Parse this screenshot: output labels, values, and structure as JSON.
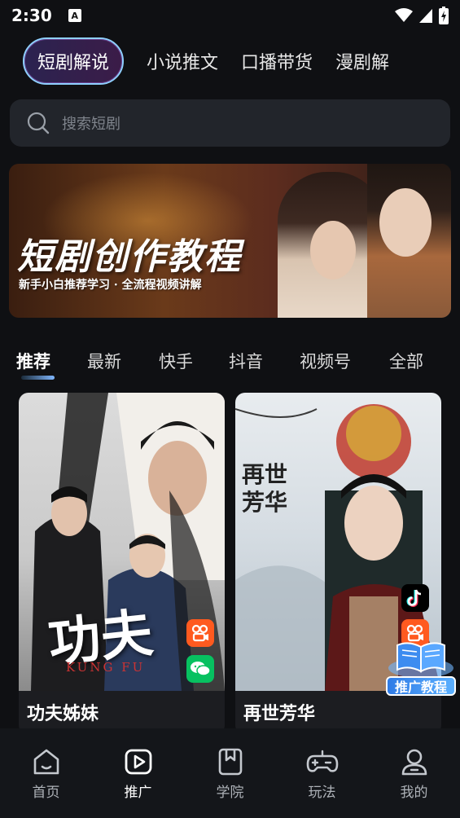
{
  "status": {
    "time": "2:30",
    "app_letter": "A"
  },
  "top_tabs": [
    {
      "label": "短剧解说",
      "active": true
    },
    {
      "label": "小说推文",
      "active": false
    },
    {
      "label": "口播带货",
      "active": false
    },
    {
      "label": "漫剧解",
      "active": false
    }
  ],
  "search": {
    "placeholder": "搜索短剧"
  },
  "banner": {
    "title": "短剧创作教程",
    "subtitle": "新手小白推荐学习 · 全流程视频讲解"
  },
  "category_tabs": [
    {
      "label": "推荐",
      "active": true
    },
    {
      "label": "最新",
      "active": false
    },
    {
      "label": "快手",
      "active": false
    },
    {
      "label": "抖音",
      "active": false
    },
    {
      "label": "视频号",
      "active": false
    },
    {
      "label": "全部",
      "active": false
    }
  ],
  "cards": [
    {
      "title": "功夫姊妹",
      "poster_text_cn": "功夫",
      "poster_text_en": "KUNG FU",
      "platform_icons": [
        "kuaishou-icon",
        "wechat-channels-icon"
      ]
    },
    {
      "title": "再世芳华",
      "poster_text_cn": "再世芳华",
      "platform_icons": [
        "douyin-icon",
        "kuaishou-icon"
      ]
    }
  ],
  "float_button": {
    "label": "推广教程"
  },
  "bottom_nav": [
    {
      "label": "首页",
      "icon": "home-icon",
      "active": false
    },
    {
      "label": "推广",
      "icon": "play-square-icon",
      "active": true
    },
    {
      "label": "学院",
      "icon": "bookmark-book-icon",
      "active": false
    },
    {
      "label": "玩法",
      "icon": "gamepad-icon",
      "active": false
    },
    {
      "label": "我的",
      "icon": "user-icon",
      "active": false
    }
  ],
  "colors": {
    "background": "#0f1013",
    "accent": "#8fd0ff",
    "kuaishou": "#ff5a1f",
    "wechat": "#07c160"
  }
}
